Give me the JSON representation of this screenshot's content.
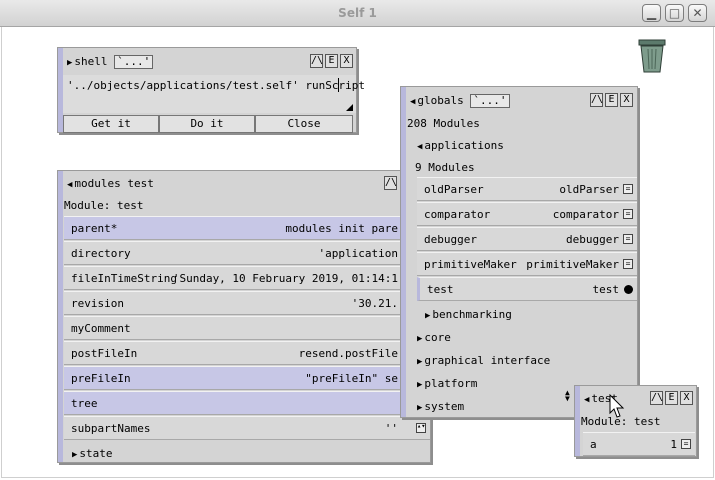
{
  "window": {
    "title": "Self 1",
    "minimize_glyph": "▁",
    "maximize_glyph": "□",
    "close_glyph": "✕"
  },
  "trash": {
    "icon": "trash-can-icon"
  },
  "shell": {
    "title": "shell",
    "menu_label": "`...'",
    "buttons": {
      "collapse": "/\\",
      "edit": "E",
      "close": "X"
    },
    "code": "'../objects/applications/test.self' runScript",
    "actions": {
      "get": "Get it",
      "do": "Do it",
      "close": "Close"
    }
  },
  "modules_test": {
    "title": "modules test",
    "collapse_btn": "/\\",
    "module_line": "Module: test",
    "slots": [
      {
        "name": "parent*",
        "value": "modules init pare",
        "hl": true
      },
      {
        "name": "directory",
        "value": "'application",
        "hl": false
      },
      {
        "name": "fileInTimeString",
        "value": "'Sunday, 10 February 2019, 01:14:1",
        "hl": false
      },
      {
        "name": "revision",
        "value": "'30.21.",
        "hl": false
      },
      {
        "name": "myComment",
        "value": "",
        "hl": false
      },
      {
        "name": "postFileIn",
        "value": "resend.postFile",
        "hl": false
      },
      {
        "name": "preFileIn",
        "value": "\"preFileIn\" se",
        "hl": true
      },
      {
        "name": "tree",
        "value": "",
        "hl": true
      },
      {
        "name": "subpartNames",
        "value": "''",
        "hl": false
      }
    ],
    "state_label": "state"
  },
  "globals": {
    "title": "globals",
    "menu_label": "`...'",
    "buttons": {
      "collapse": "/\\",
      "edit": "E",
      "close": "X"
    },
    "count": "208 Modules",
    "applications_label": "applications",
    "applications_count": "9 Modules",
    "slots": [
      {
        "name": "oldParser",
        "value": "oldParser"
      },
      {
        "name": "comparator",
        "value": "comparator"
      },
      {
        "name": "debugger",
        "value": "debugger"
      },
      {
        "name": "primitiveMaker",
        "value": "primitiveMaker"
      },
      {
        "name": "test",
        "value": "test"
      }
    ],
    "benchmarking": "benchmarking",
    "categories": [
      "core",
      "graphical interface",
      "platform",
      "system"
    ]
  },
  "test_outliner": {
    "title": "test",
    "buttons": {
      "collapse": "/\\",
      "edit": "E",
      "close": "X"
    },
    "module_line": "Module: test",
    "slot": {
      "name": "a",
      "value": "1"
    }
  }
}
